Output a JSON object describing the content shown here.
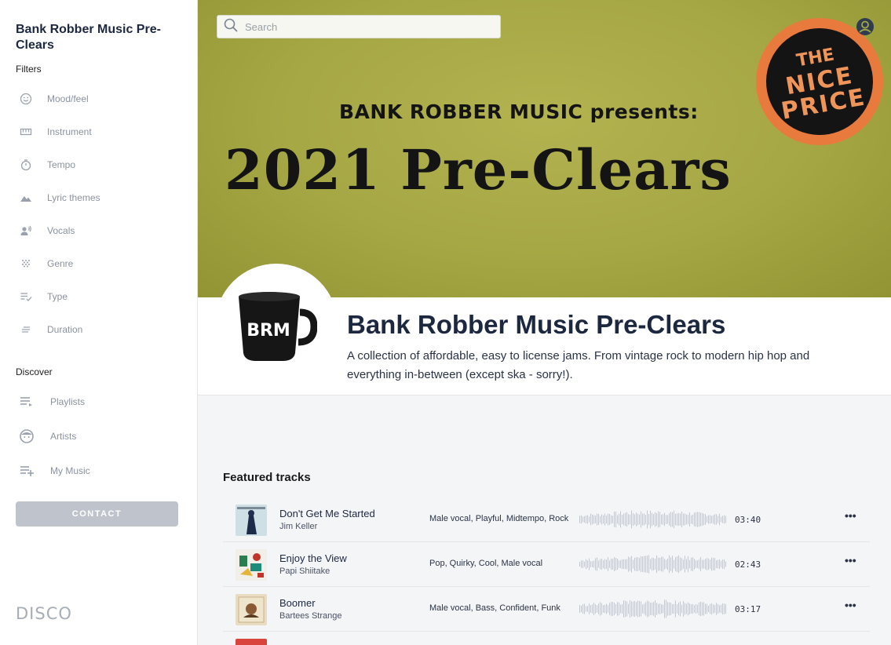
{
  "sidebar": {
    "title": "Bank Robber Music Pre-Clears",
    "filters_label": "Filters",
    "filters": [
      {
        "label": "Mood/feel",
        "icon": "smiley-icon"
      },
      {
        "label": "Instrument",
        "icon": "keyboard-icon"
      },
      {
        "label": "Tempo",
        "icon": "stopwatch-icon"
      },
      {
        "label": "Lyric themes",
        "icon": "mountain-icon"
      },
      {
        "label": "Vocals",
        "icon": "voice-icon"
      },
      {
        "label": "Genre",
        "icon": "dots-grid-icon"
      },
      {
        "label": "Type",
        "icon": "list-check-icon"
      },
      {
        "label": "Duration",
        "icon": "lines-icon"
      }
    ],
    "discover_label": "Discover",
    "discover": [
      {
        "label": "Playlists",
        "icon": "playlist-icon"
      },
      {
        "label": "Artists",
        "icon": "face-icon"
      },
      {
        "label": "My Music",
        "icon": "playlist-add-icon"
      }
    ],
    "contact_label": "CONTACT",
    "brand": "DISCO"
  },
  "search": {
    "placeholder": "Search"
  },
  "banner": {
    "presents": "BANK ROBBER MUSIC presents:",
    "title": "2021 Pre-Clears",
    "badge": {
      "line1": "THE",
      "line2": "NICE",
      "line3": "PRICE"
    }
  },
  "header": {
    "logo_text": "BRM",
    "title": "Bank Robber Music Pre-Clears",
    "description": "A collection of affordable, easy to license jams. From vintage rock to modern hip hop and everything in-between (except ska - sorry!)."
  },
  "featured": {
    "label": "Featured tracks",
    "tracks": [
      {
        "title": "Don't Get Me Started",
        "artist": "Jim Keller",
        "tags": "Male vocal, Playful, Midtempo, Rock",
        "duration": "03:40"
      },
      {
        "title": "Enjoy the View",
        "artist": "Papi Shiitake",
        "tags": "Pop, Quirky, Cool, Male vocal",
        "duration": "02:43"
      },
      {
        "title": "Boomer",
        "artist": "Bartees Strange",
        "tags": "Male vocal, Bass, Confident, Funk",
        "duration": "03:17"
      }
    ],
    "more_label": "•••"
  },
  "colors": {
    "banner": "#a5a744",
    "badge": "#e97a3e",
    "accent": "#1c2740"
  }
}
